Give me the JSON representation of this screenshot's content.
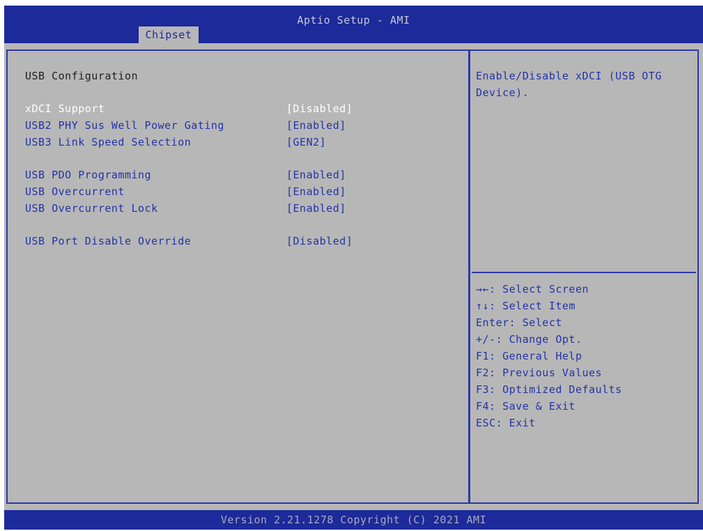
{
  "header": {
    "title": "Aptio Setup - AMI",
    "active_tab": "Chipset"
  },
  "main": {
    "section_title": "USB Configuration",
    "items": [
      {
        "label": "xDCI Support",
        "value": "[Disabled]",
        "selected": true
      },
      {
        "label": "USB2 PHY Sus Well Power Gating",
        "value": "[Enabled]",
        "selected": false
      },
      {
        "label": "USB3 Link Speed Selection",
        "value": "[GEN2]",
        "selected": false
      },
      {
        "label": "USB PDO Programming",
        "value": "[Enabled]",
        "selected": false
      },
      {
        "label": "USB Overcurrent",
        "value": "[Enabled]",
        "selected": false
      },
      {
        "label": "USB Overcurrent Lock",
        "value": "[Enabled]",
        "selected": false
      },
      {
        "label": "USB Port Disable Override",
        "value": "[Disabled]",
        "selected": false
      }
    ]
  },
  "help": {
    "text": "Enable/Disable xDCI (USB OTG Device)."
  },
  "keys": [
    "→←: Select Screen",
    "↑↓: Select Item",
    "Enter: Select",
    "+/-: Change Opt.",
    "F1: General Help",
    "F2: Previous Values",
    "F3: Optimized Defaults",
    "F4: Save & Exit",
    "ESC: Exit"
  ],
  "footer": {
    "version": "Version 2.21.1278 Copyright (C) 2021 AMI"
  },
  "colors": {
    "header_bg": "#1c2a9a",
    "panel_bg": "#b7b7b7",
    "option_text": "#2233a8",
    "selected_text": "#ffffff"
  }
}
